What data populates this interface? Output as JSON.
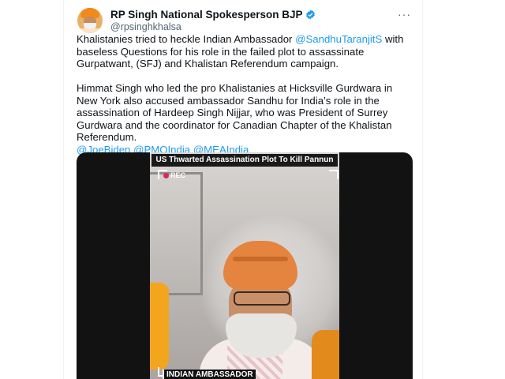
{
  "account": {
    "name": "RP Singh National Spokesperson BJP",
    "handle": "@rpsinghkhalsa",
    "more_label": "···"
  },
  "tweet": {
    "p1_a": "Khalistanies tried to heckle Indian Ambassador ",
    "p1_mention": "@SandhuTaranjitS",
    "p1_b": " with baseless Questions for his role in the failed plot to assassinate Gurpatwant, (SFJ) and Khalistan Referendum campaign.",
    "p2": "Himmat Singh who led the pro Khalistanies at Hicksville Gurdwara in New York also accused ambassador Sandhu for India’s role in the assassination of Hardeep Singh Nijjar, who was President of Surrey Gurdwara and the coordinator for Canadian Chapter of the Khalistan Referendum.",
    "mentions": [
      "@JoeBiden",
      "@PMOIndia",
      "@MEAIndia"
    ]
  },
  "video": {
    "banner": "US Thwarted Assassination Plot To Kill Pannun",
    "rec_label": "REC",
    "caption": "INDIAN AMBASSADOR"
  },
  "colors": {
    "link": "#1d9bf0",
    "verified": "#1d9bf0",
    "text": "#0f1419",
    "muted": "#536471"
  }
}
